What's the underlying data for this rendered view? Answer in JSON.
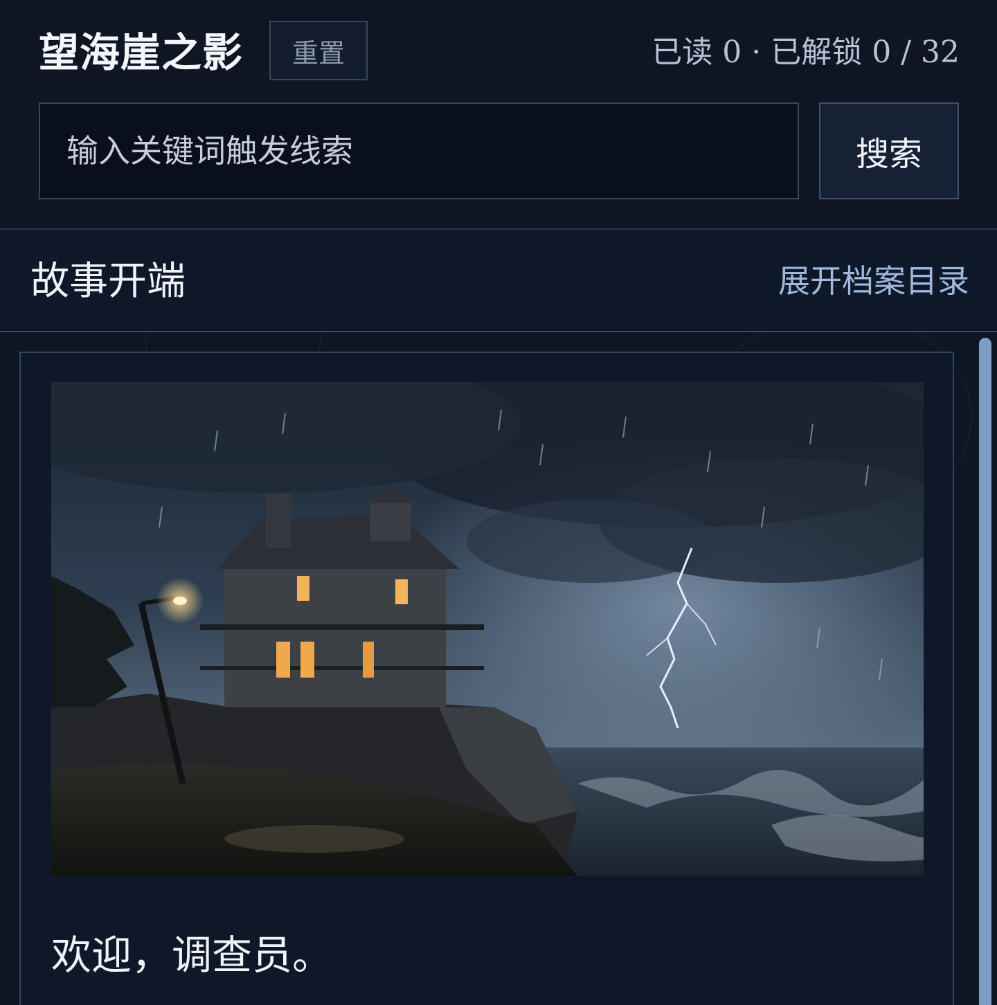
{
  "header": {
    "title": "望海崖之影",
    "reset_label": "重置",
    "progress": "已读 0 · 已解锁 0 / 32"
  },
  "search": {
    "placeholder": "输入关键词触发线索",
    "button_label": "搜索"
  },
  "section": {
    "title": "故事开端",
    "toc_link": "展开档案目录"
  },
  "story": {
    "text": "欢迎，调查员。"
  },
  "colors": {
    "background": "#0e1624",
    "panel": "#0f1828",
    "border": "#34465f",
    "accent_link": "#9fb8de",
    "scrollbar": "#7d9cc6"
  }
}
